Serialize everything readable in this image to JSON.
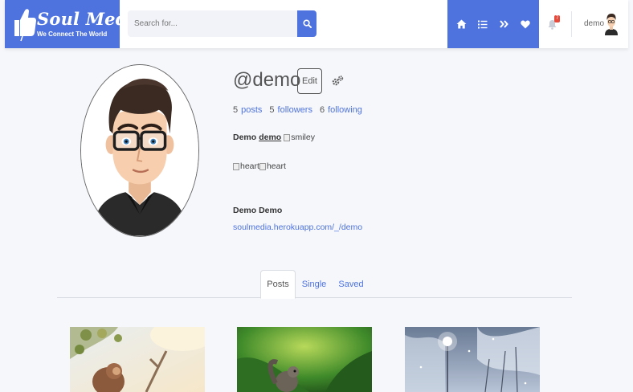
{
  "header": {
    "brand": "Soul Media",
    "tagline": "We Connect The World",
    "search_placeholder": "Search for...",
    "nav_icons": [
      "home-icon",
      "list-icon",
      "angle-double-right-icon",
      "heart-icon"
    ],
    "notification_count": "7",
    "username": "demo"
  },
  "profile": {
    "handle": "@demo",
    "edit_label": "Edit",
    "stats": [
      {
        "num": "5",
        "label": "posts"
      },
      {
        "num": "5",
        "label": "followers"
      },
      {
        "num": "6",
        "label": "following"
      }
    ],
    "first_name": "Demo",
    "last_name": "demo",
    "name_emoji_alt": "smiley",
    "heart_alts": [
      "heart",
      "heart"
    ],
    "full_name": "Demo Demo",
    "website": "soulmedia.herokuapp.com/_/demo"
  },
  "tabs": [
    {
      "label": "Posts",
      "active": true
    },
    {
      "label": "Single",
      "active": false
    },
    {
      "label": "Saved",
      "active": false
    }
  ],
  "colors": {
    "accent": "#4e73df",
    "background": "#f5f7fb",
    "badge": "#e74a3b"
  }
}
